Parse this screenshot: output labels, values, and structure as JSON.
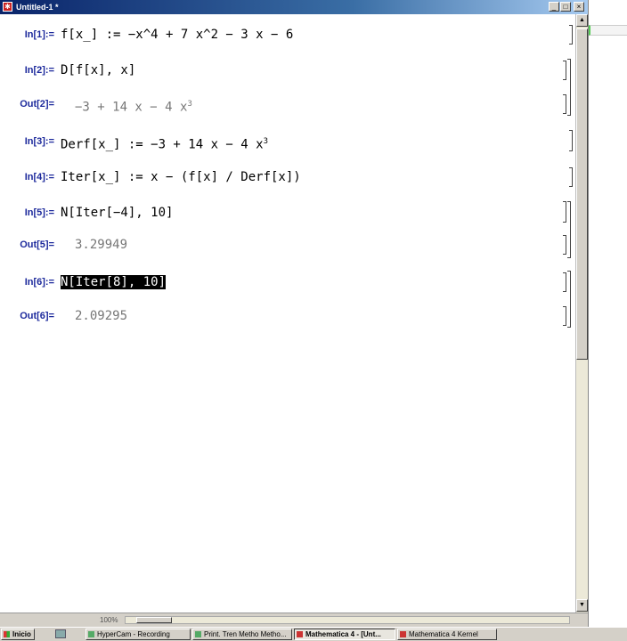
{
  "window": {
    "title": "Untitled-1 *",
    "buttons": {
      "minimize": "_",
      "maximize": "□",
      "close": "×"
    }
  },
  "cells": [
    {
      "label": "In[1]:=",
      "code": "f[x_] := −x^4 + 7 x^2 − 3 x − 6"
    },
    {
      "label": "In[2]:=",
      "code": "D[f[x], x]"
    },
    {
      "label": "Out[2]=",
      "code_main": "−3 + 14 x − 4 x",
      "code_sup": "3"
    },
    {
      "label": "In[3]:=",
      "code_main": "Derf[x_] := −3 + 14 x − 4 x",
      "code_sup": "3"
    },
    {
      "label": "In[4]:=",
      "code": "Iter[x_] := x − (f[x] / Derf[x])"
    },
    {
      "label": "In[5]:=",
      "code": "N[Iter[−4], 10]"
    },
    {
      "label": "Out[5]=",
      "code": "3.29949"
    },
    {
      "label": "In[6]:=",
      "code": "N[Iter[8], 10]"
    },
    {
      "label": "Out[6]=",
      "code": "2.09295"
    }
  ],
  "statusbar": {
    "zoom": "100%"
  },
  "taskbar": {
    "start": "Inicio",
    "items": [
      {
        "label": "HyperCam - Recording"
      },
      {
        "label": "Print. Tren Metho Metho..."
      },
      {
        "label": "Mathematica 4 - [Unt..."
      },
      {
        "label": "Mathematica 4 Kernel"
      }
    ]
  },
  "icons": [
    "mathematica-app-icon",
    "windows-start-flag-icon",
    "quick-launch-icon"
  ],
  "colors": {
    "label": "#1d2a9c",
    "output": "#777777",
    "titlebar": "#0a246a"
  }
}
